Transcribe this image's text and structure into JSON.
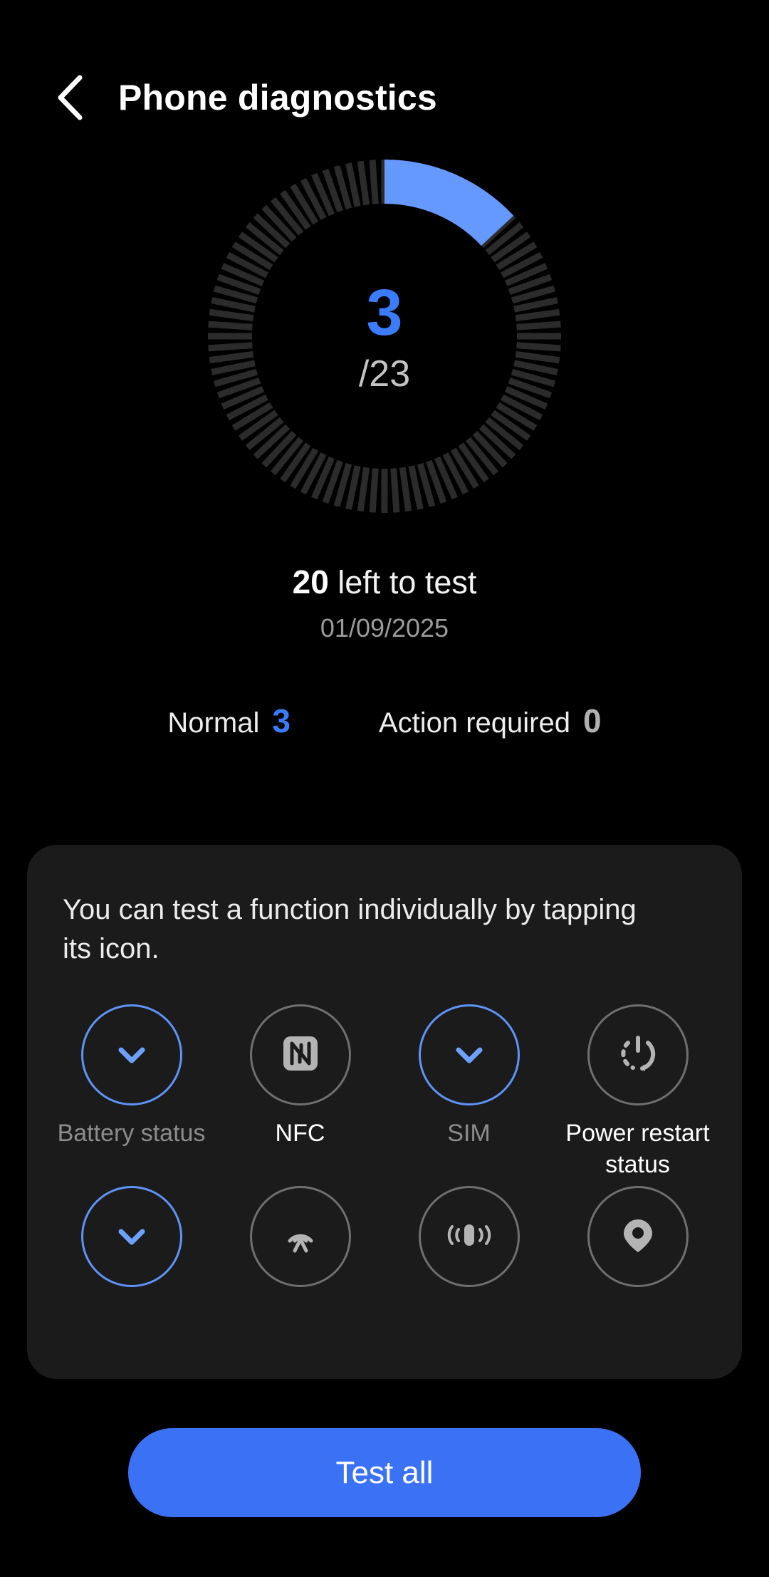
{
  "header": {
    "back_icon": "chevron-left-icon",
    "title": "Phone diagnostics"
  },
  "gauge": {
    "tested": "3",
    "total": "/23",
    "tested_count": 3,
    "total_count": 23,
    "progress_percent": 13,
    "arc_color": "#6699ff",
    "track_color": "#2b2b2b"
  },
  "summary": {
    "remaining": "20",
    "remaining_label": " left to test",
    "date": "01/09/2025"
  },
  "stats": {
    "normal_label": "Normal",
    "normal_value": "3",
    "action_label": "Action required",
    "action_value": "0",
    "normal_color": "#3b7cff",
    "action_color": "#b0b0b0"
  },
  "card": {
    "description": "You can test a function individually by tapping its icon.",
    "items": [
      {
        "icon": "check-icon",
        "label": "Battery status",
        "tested": true,
        "dim_label": true
      },
      {
        "icon": "nfc-icon",
        "label": "NFC",
        "tested": false,
        "dim_label": false
      },
      {
        "icon": "check-icon",
        "label": "SIM",
        "tested": true,
        "dim_label": true
      },
      {
        "icon": "power-restart-icon",
        "label": "Power restart status",
        "tested": false,
        "dim_label": false
      },
      {
        "icon": "check-icon",
        "label": "",
        "tested": true,
        "dim_label": true
      },
      {
        "icon": "broadcast-icon",
        "label": "",
        "tested": false,
        "dim_label": false
      },
      {
        "icon": "vibration-icon",
        "label": "",
        "tested": false,
        "dim_label": false
      },
      {
        "icon": "location-pin-icon",
        "label": "",
        "tested": false,
        "dim_label": false
      }
    ]
  },
  "footer": {
    "test_all_label": "Test all",
    "button_color": "#3b72f5"
  }
}
